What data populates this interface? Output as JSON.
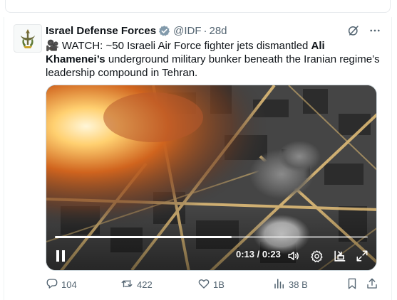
{
  "tweet": {
    "author_name": "Israel Defense Forces",
    "handle": "@IDF",
    "separator": "·",
    "time": "28d",
    "text_prefix": "🎥 WATCH: ~50 Israeli Air Force fighter jets dismantled ",
    "text_bold": "Ali Khamenei’s",
    "text_suffix": " underground military bunker beneath the Iranian regime’s leadership compound in Tehran."
  },
  "video": {
    "time_readout": "0:13 / 0:23",
    "progress": 0.565
  },
  "actions": {
    "replies": "104",
    "reposts": "422",
    "likes": "1B",
    "views": "38 B"
  },
  "icons": {
    "header": [
      "grok-icon",
      "more-icon"
    ],
    "video_controls": [
      "pause-icon",
      "volume-icon",
      "settings-icon",
      "dock-icon",
      "fullscreen-icon"
    ],
    "actions": [
      "reply-icon",
      "repost-icon",
      "like-icon",
      "views-icon",
      "bookmark-icon",
      "share-icon"
    ]
  },
  "colors": {
    "text": "#0f1419",
    "secondary": "#536471",
    "verified": "#829aab"
  }
}
